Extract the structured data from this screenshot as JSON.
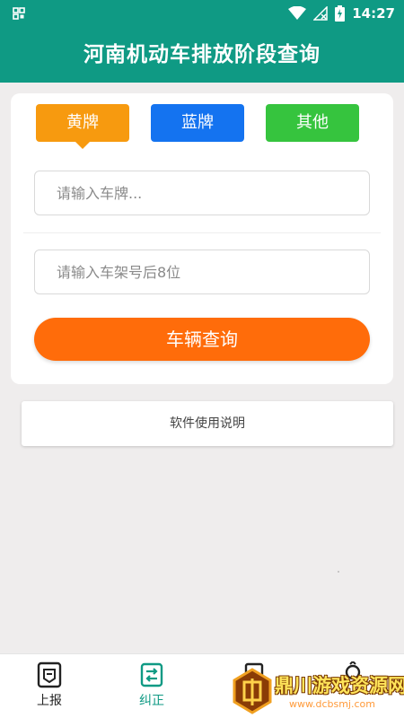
{
  "status_bar": {
    "time": "14:27",
    "icons": [
      "grid-icon",
      "wifi-icon",
      "no-signal-icon",
      "battery-charging-icon"
    ]
  },
  "header": {
    "title": "河南机动车排放阶段查询"
  },
  "plate_types": [
    {
      "label": "黄牌",
      "color": "#f79a0f",
      "selected": true
    },
    {
      "label": "蓝牌",
      "color": "#1473f0"
    },
    {
      "label": "其他",
      "color": "#36c43e"
    }
  ],
  "form": {
    "plate_placeholder": "请输入车牌...",
    "vin_placeholder": "请输入车架号后8位",
    "query_label": "车辆查询"
  },
  "manual_label": "软件使用说明",
  "bottom_nav": {
    "items": [
      {
        "label": "上报",
        "icon": "report-icon"
      },
      {
        "label": "纠正",
        "icon": "correct-icon",
        "active": true
      },
      {
        "label": "",
        "icon": "document-icon"
      },
      {
        "label": "",
        "icon": "person-icon"
      }
    ]
  },
  "watermark": {
    "title": "鼎川游戏资源网",
    "url": "www.dcbsmj.com"
  },
  "colors": {
    "primary": "#0f9a84",
    "accent": "#ff6c0a"
  }
}
